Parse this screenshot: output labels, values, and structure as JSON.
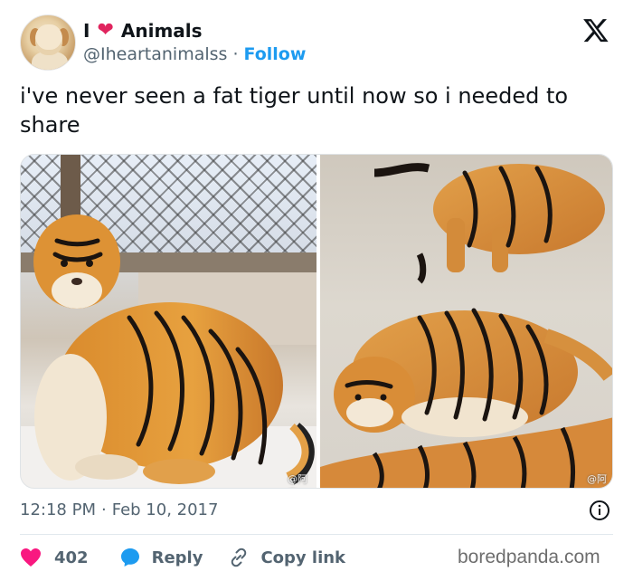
{
  "author": {
    "name_prefix": "I",
    "name_suffix": "Animals",
    "handle": "@Iheartanimalss",
    "follow_label": "Follow"
  },
  "tweet": {
    "text": "i've never seen a fat tiger until now so i needed to share",
    "time": "12:18 PM",
    "separator": "·",
    "date": "Feb 10, 2017"
  },
  "media": {
    "watermark_left": "@阿喜",
    "watermark_right": "@阿喜"
  },
  "actions": {
    "like_count": "402",
    "reply_label": "Reply",
    "copy_label": "Copy link"
  },
  "footer": {
    "brand": "boredpanda.com"
  },
  "colors": {
    "heart": "#e0245e",
    "link_blue": "#1d9bf0",
    "muted": "#536471",
    "reply_blue": "#1d9bf0"
  }
}
